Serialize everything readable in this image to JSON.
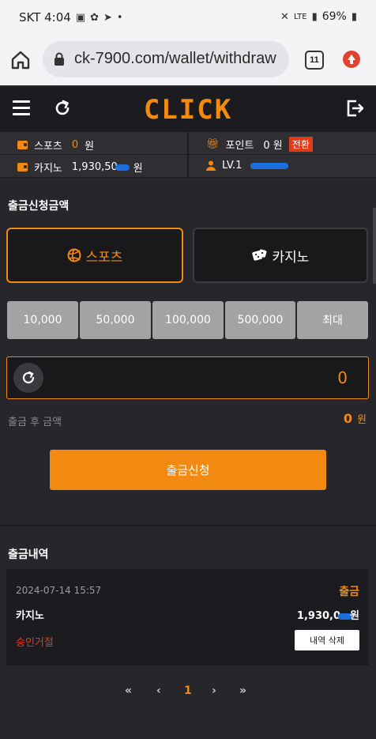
{
  "status_bar": {
    "carrier_time": "SKT 4:04",
    "lte_label": "LTE",
    "battery": "69%"
  },
  "browser": {
    "url": "ck-7900.com/wallet/withdraw",
    "tab_count": "11"
  },
  "header": {
    "logo": "CLICK"
  },
  "info_bar": {
    "sports_label": "스포츠",
    "sports_value": "0",
    "sports_unit": "원",
    "casino_label": "카지노",
    "casino_value_a": "1,930,50",
    "casino_value_b": "",
    "casino_unit": "원",
    "point_label": "포인트",
    "point_value": "0 원",
    "swap_label": "전환",
    "level_label": "LV.1"
  },
  "withdraw": {
    "section_title": "출금신청금액",
    "tab_sports": "스포츠",
    "tab_casino": "카지노",
    "amount_buttons": [
      "10,000",
      "50,000",
      "100,000",
      "500,000",
      "최대"
    ],
    "input_value": "0",
    "after_label": "출금 후 금액",
    "after_value": "0",
    "after_unit": "원",
    "submit_label": "출금신청"
  },
  "history": {
    "section_title": "출금내역",
    "items": [
      {
        "date": "2024-07-14 15:57",
        "type": "출금",
        "category": "카지노",
        "amount_a": "1,930,0",
        "amount_b": "원",
        "status": "승인거절",
        "delete_label": "내역 삭제"
      }
    ]
  },
  "pagination": {
    "first": "«",
    "prev": "‹",
    "current": "1",
    "next": "›",
    "last": "»"
  },
  "colors": {
    "accent": "#f28a12",
    "background": "#27272b",
    "panel": "#1c1c20",
    "danger": "#e33b1a"
  }
}
